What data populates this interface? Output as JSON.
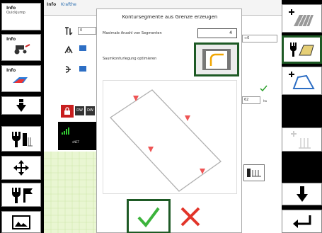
{
  "left_toolbar": {
    "quickjump": {
      "info": "Info",
      "sub": "Quickjump"
    },
    "tractor_info": {
      "info": "Info"
    },
    "implement_info": {
      "info": "Info"
    }
  },
  "background": {
    "header_info": "Info",
    "header_title": "Krafthe",
    "field_1": "0",
    "field_2": "∞0",
    "right_value": "62",
    "right_unit": "ha",
    "signal_label": "sNET",
    "red_lock_badge": "DW",
    "red_lock_badge_2": "DW"
  },
  "dialog": {
    "title": "Kontursegmente aus Grenze erzeugen",
    "max_segments_label": "Maximale Anzahl von Segmenten",
    "max_segments_value": "4",
    "optimize_label": "Saumkonturlegung optimieren"
  },
  "colors": {
    "accent_green": "#1e5a25",
    "ok_green": "#3cb33c",
    "cancel_red": "#e2352a",
    "marker_red": "#ee5555",
    "blue": "#2d6ec4"
  }
}
